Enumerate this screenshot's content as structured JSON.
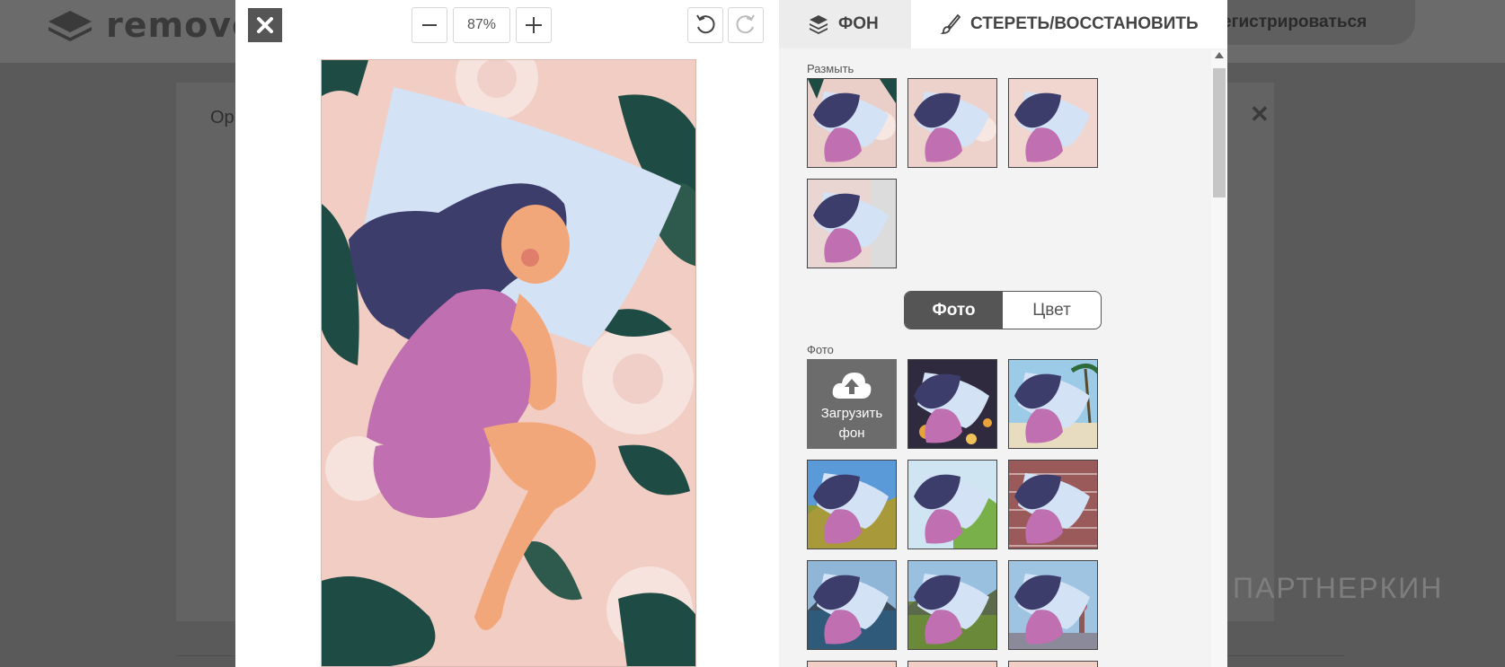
{
  "background_page": {
    "logo_text": "remove",
    "register_label": "егистрироваться",
    "panel_text": "Ор"
  },
  "watermark": {
    "text": "ПАРТНЕРКИН"
  },
  "toolbar": {
    "zoom_value": "87%"
  },
  "tabs": {
    "background": "ФОН",
    "erase_restore": "СТЕРЕТЬ/ВОССТАНОВИТЬ"
  },
  "blur_section": {
    "label": "Размыть",
    "thumbs": [
      "blur-1",
      "blur-2",
      "blur-3",
      "blur-4"
    ]
  },
  "mode_toggle": {
    "photo": "Фото",
    "color": "Цвет",
    "selected": "Фото"
  },
  "photo_section": {
    "label": "Фото",
    "upload_label": "Загрузить фон",
    "thumbs": [
      {
        "name": "city-lights"
      },
      {
        "name": "beach-palms"
      },
      {
        "name": "mountains"
      },
      {
        "name": "tropical-sky"
      },
      {
        "name": "brick-wall"
      },
      {
        "name": "lake"
      },
      {
        "name": "valley"
      },
      {
        "name": "city-tower"
      }
    ]
  },
  "colors": {
    "canvas_bg": "#f1cdc3",
    "hair": "#3d3d6b",
    "pillow": "#d3e2f5",
    "pajama": "#c06fb0",
    "skin": "#f2a77b",
    "leaf": "#1f4b45"
  }
}
